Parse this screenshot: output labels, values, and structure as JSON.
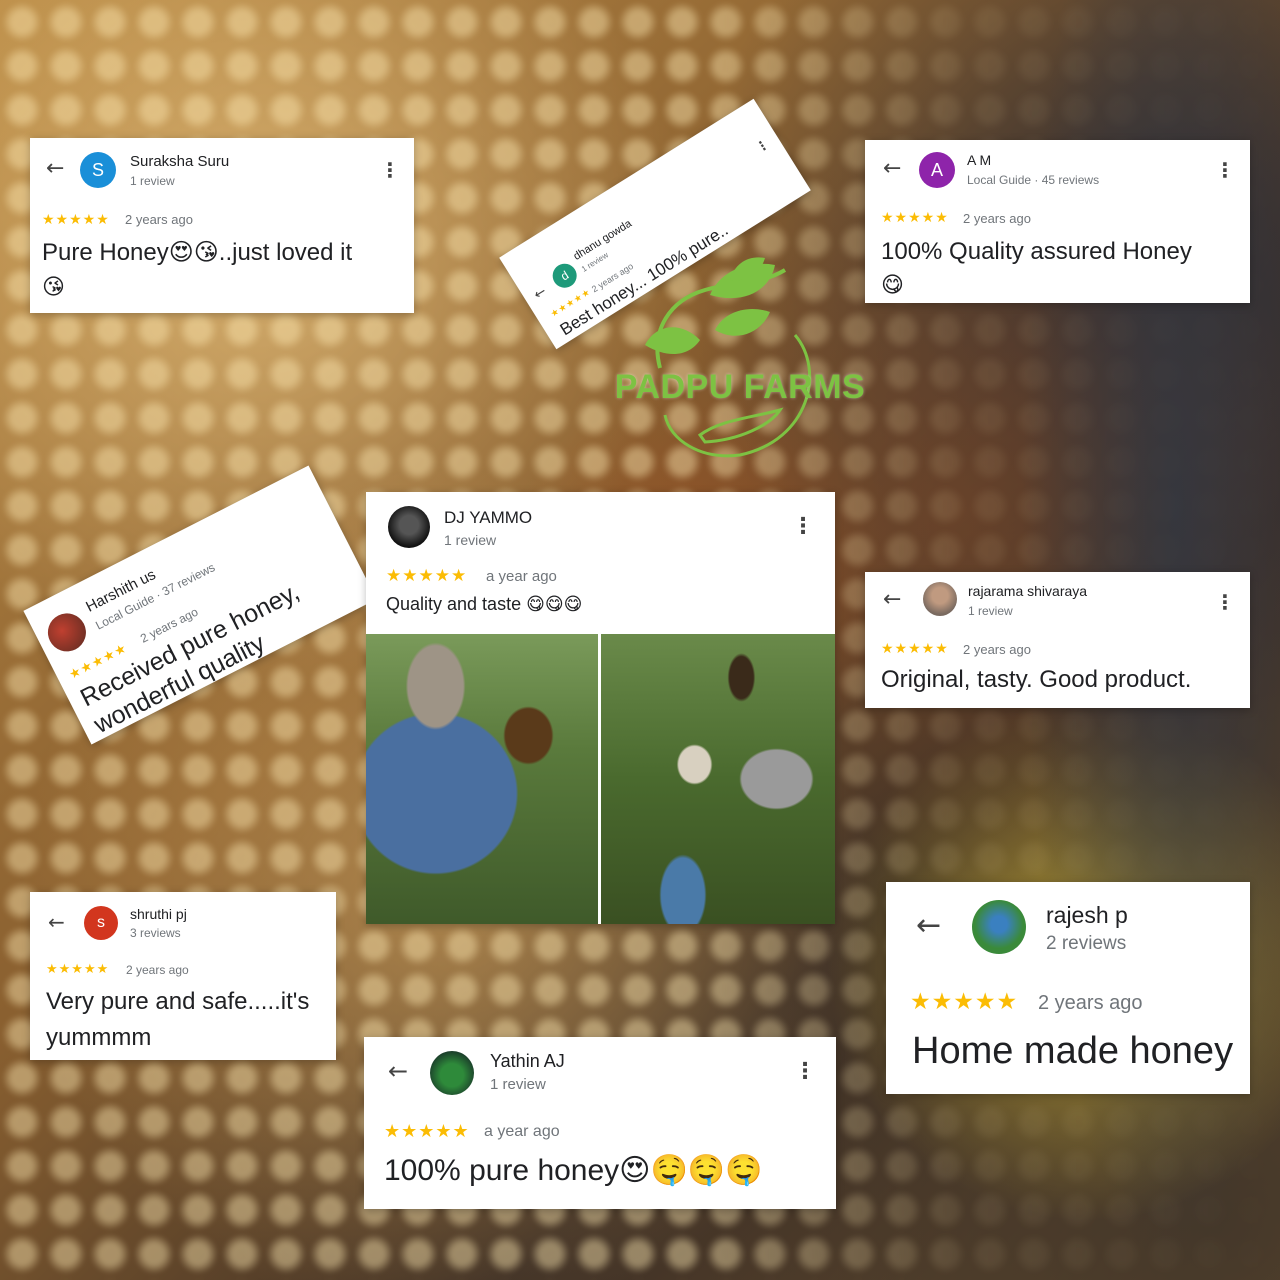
{
  "brand": {
    "name": "PADPU FARMS",
    "color": "#7dc243"
  },
  "reviews": {
    "suraksha": {
      "initial": "S",
      "avatar_color": "#1a8fd8",
      "name": "Suraksha Suru",
      "sub": "1 review",
      "stars": "★★★★★",
      "when": "2 years ago",
      "text_line1": "Pure Honey😍😘..just loved it",
      "text_line2": "😘"
    },
    "dhanu": {
      "initial": "d",
      "avatar_color": "#1e9a7a",
      "name": "dhanu gowda",
      "sub": "1 review",
      "stars": "★★★★★",
      "when": "2 years ago",
      "text": "Best honey... 100% pure.."
    },
    "am": {
      "initial": "A",
      "avatar_color": "#8e24aa",
      "name": "A M",
      "sub": "Local Guide · 45 reviews",
      "stars": "★★★★★",
      "when": "2 years ago",
      "text_line1": "100% Quality assured Honey",
      "text_line2": "😋"
    },
    "harshith": {
      "name": "Harshith us",
      "sub": "Local Guide · 37 reviews",
      "stars": "★★★★★",
      "when": "2 years ago",
      "text_line1": "Received pure honey,",
      "text_line2": "wonderful quality"
    },
    "djyammo": {
      "name": "DJ YAMMO",
      "sub": "1 review",
      "stars": "★★★★★",
      "when": "a year ago",
      "text": "Quality and taste 😋😋😋"
    },
    "rajarama": {
      "name": "rajarama shivaraya",
      "sub": "1 review",
      "stars": "★★★★★",
      "when": "2 years ago",
      "text": "Original, tasty. Good product."
    },
    "shruthi": {
      "initial": "s",
      "avatar_color": "#d2361e",
      "name": "shruthi pj",
      "sub": "3 reviews",
      "stars": "★★★★★",
      "when": "2 years ago",
      "text_line1": "Very pure and safe.....it's",
      "text_line2": "yummmm"
    },
    "yathin": {
      "name": "Yathin AJ",
      "sub": "1 review",
      "stars": "★★★★★",
      "when": "a year ago",
      "text": "100% pure honey😍🤤🤤🤤"
    },
    "rajesh": {
      "name": "rajesh p",
      "sub": "2 reviews",
      "stars": "★★★★★",
      "when": "2 years ago",
      "text": "Home made honey"
    }
  },
  "icons": {
    "back": "←",
    "menu": "⋮"
  }
}
